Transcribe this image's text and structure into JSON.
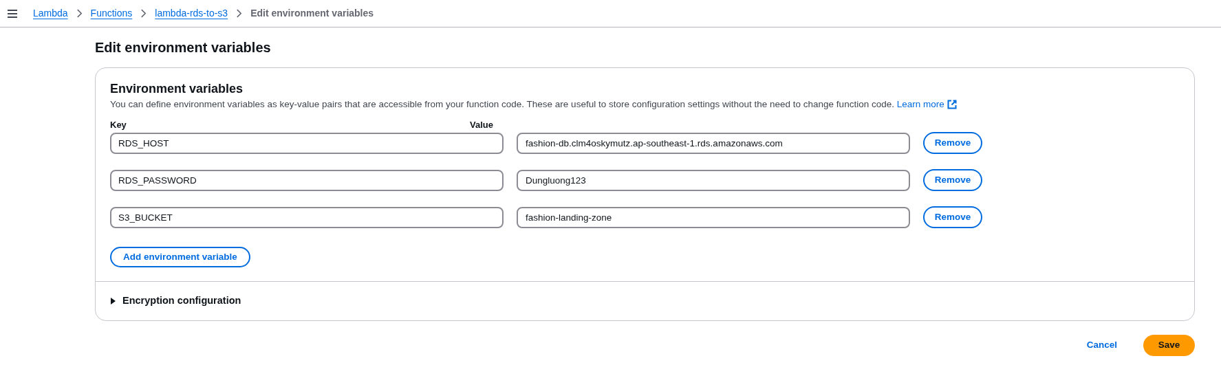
{
  "breadcrumbs": [
    {
      "label": "Lambda",
      "kind": "link"
    },
    {
      "label": "Functions",
      "kind": "link"
    },
    {
      "label": "lambda-rds-to-s3",
      "kind": "link"
    },
    {
      "label": "Edit environment variables",
      "kind": "current"
    }
  ],
  "page_title": "Edit environment variables",
  "panel": {
    "title": "Environment variables",
    "description": "You can define environment variables as key-value pairs that are accessible from your function code. These are useful to store configuration settings without the need to change function code.",
    "learn_more": "Learn more",
    "key_label": "Key",
    "value_label": "Value",
    "variables": [
      {
        "key": "RDS_HOST",
        "value": "fashion-db.clm4oskymutz.ap-southeast-1.rds.amazonaws.com",
        "remove": "Remove"
      },
      {
        "key": "RDS_PASSWORD",
        "value": "Dungluong123",
        "remove": "Remove"
      },
      {
        "key": "S3_BUCKET",
        "value": "fashion-landing-zone",
        "remove": "Remove"
      }
    ],
    "add_button": "Add environment variable",
    "encryption": {
      "label": "Encryption configuration",
      "expanded": false
    }
  },
  "footer": {
    "cancel": "Cancel",
    "save": "Save"
  }
}
